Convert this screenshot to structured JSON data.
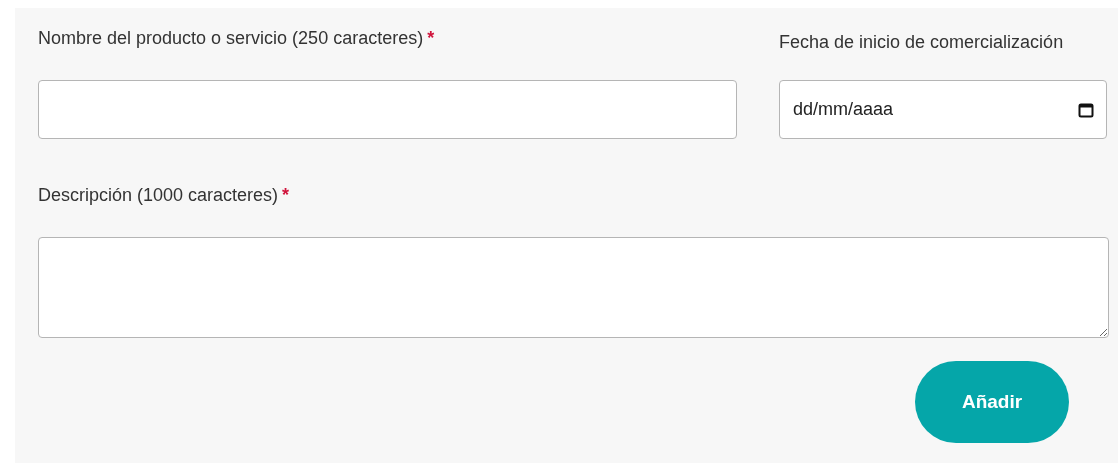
{
  "form": {
    "name_field": {
      "label": "Nombre del producto o servicio (250 caracteres)",
      "required_mark": "*"
    },
    "date_field": {
      "label": "Fecha de inicio de comercialización",
      "placeholder": "dd/mm/aaaa"
    },
    "description_field": {
      "label": "Descripción (1000 caracteres)",
      "required_mark": "*"
    },
    "submit_button": {
      "label": "Añadir"
    }
  }
}
